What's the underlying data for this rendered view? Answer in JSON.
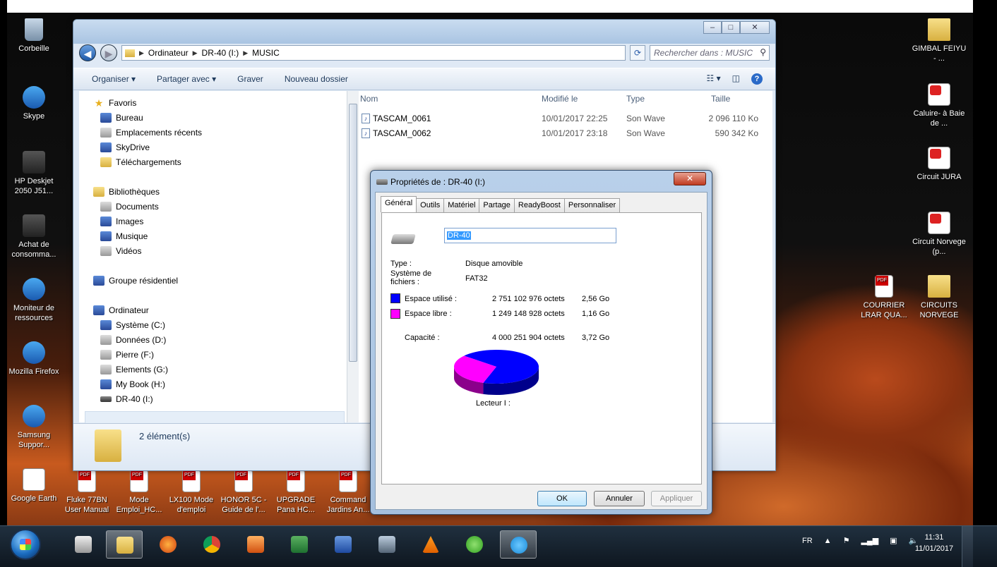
{
  "desktop": {
    "left_icons": [
      {
        "name": "corbeille",
        "label": "Corbeille",
        "icon": "bin"
      },
      {
        "name": "skype",
        "label": "Skype",
        "icon": "blue"
      },
      {
        "name": "hp-deskjet",
        "label": "HP Deskjet 2050 J51...",
        "icon": "printer"
      },
      {
        "name": "achat",
        "label": "Achat de consomma...",
        "icon": "printer"
      },
      {
        "name": "moniteur",
        "label": "Moniteur de ressources",
        "icon": "blue"
      },
      {
        "name": "firefox",
        "label": "Mozilla Firefox",
        "icon": "blue"
      },
      {
        "name": "samsung",
        "label": "Samsung Suppor...",
        "icon": "blue"
      },
      {
        "name": "google-earth",
        "label": "Google Earth",
        "icon": "doc"
      }
    ],
    "bottom_icons": [
      {
        "name": "fluke",
        "label": "Fluke 77BN User Manual"
      },
      {
        "name": "mode-emploi",
        "label": "Mode Emploi_HC..."
      },
      {
        "name": "lx100",
        "label": "LX100 Mode d'emploi"
      },
      {
        "name": "honor",
        "label": "HONOR 5C - Guide de l'..."
      },
      {
        "name": "upgrade",
        "label": "UPGRADE Pana HC..."
      },
      {
        "name": "commandes",
        "label": "Command Jardins An..."
      }
    ],
    "right_icons": [
      {
        "name": "gimbal",
        "label": "GIMBAL FEIYU - ...",
        "icon": "folder"
      },
      {
        "name": "caluire",
        "label": "Caluire- à Baie de ...",
        "icon": "red"
      },
      {
        "name": "circuit-jura",
        "label": "Circuit JURA",
        "icon": "red"
      },
      {
        "name": "circuit-norvege",
        "label": "Circuit Norvege (p...",
        "icon": "red"
      },
      {
        "name": "circuits-norvege",
        "label": "CIRCUITS NORVEGE",
        "icon": "folder"
      },
      {
        "name": "courrier",
        "label": "COURRIER LRAR QUA...",
        "icon": "pdf"
      }
    ]
  },
  "explorer": {
    "breadcrumb": [
      "Ordinateur",
      "DR-40 (I:)",
      "MUSIC"
    ],
    "search_placeholder": "Rechercher dans : MUSIC",
    "toolbar": {
      "organiser": "Organiser ▾",
      "partager": "Partager avec ▾",
      "graver": "Graver",
      "nouveau_dossier": "Nouveau dossier"
    },
    "nav": {
      "favoris": "Favoris",
      "bureau": "Bureau",
      "emplacements": "Emplacements récents",
      "skydrive": "SkyDrive",
      "telechargements": "Téléchargements",
      "bibliotheques": "Bibliothèques",
      "documents": "Documents",
      "images": "Images",
      "musique": "Musique",
      "videos": "Vidéos",
      "groupe": "Groupe résidentiel",
      "ordinateur": "Ordinateur",
      "systeme": "Système (C:)",
      "donnees": "Données (D:)",
      "pierre": "Pierre (F:)",
      "elements": "Elements (G:)",
      "mybook": "My Book (H:)",
      "dr40": "DR-40 (I:)"
    },
    "columns": {
      "name": "Nom",
      "modified": "Modifié le",
      "type": "Type",
      "size": "Taille"
    },
    "files": [
      {
        "name": "TASCAM_0061",
        "modified": "10/01/2017 22:25",
        "type": "Son Wave",
        "size": "2 096 110 Ko"
      },
      {
        "name": "TASCAM_0062",
        "modified": "10/01/2017 23:18",
        "type": "Son Wave",
        "size": "590 342 Ko"
      }
    ],
    "status": "2 élément(s)"
  },
  "dialog": {
    "title": "Propriétés de : DR-40 (I:)",
    "tabs": [
      "Général",
      "Outils",
      "Matériel",
      "Partage",
      "ReadyBoost",
      "Personnaliser"
    ],
    "drive_name": "DR-40",
    "type_label": "Type :",
    "type_value": "Disque amovible",
    "fs_label_1": "Système de",
    "fs_label_2": "fichiers :",
    "fs_value": "FAT32",
    "used_label": "Espace utilisé :",
    "used_bytes": "2 751 102 976 octets",
    "used_human": "2,56 Go",
    "free_label": "Espace libre :",
    "free_bytes": "1 249 148 928 octets",
    "free_human": "1,16 Go",
    "capacity_label": "Capacité :",
    "capacity_bytes": "4 000 251 904 octets",
    "capacity_human": "3,72 Go",
    "drive_label": "Lecteur I :",
    "used_fraction": 0.688,
    "used_color": "#0000ff",
    "free_color": "#ff00ff",
    "buttons": {
      "ok": "OK",
      "annuler": "Annuler",
      "appliquer": "Appliquer"
    }
  },
  "taskbar": {
    "lang": "FR",
    "time": "11:31",
    "date": "11/01/2017"
  }
}
